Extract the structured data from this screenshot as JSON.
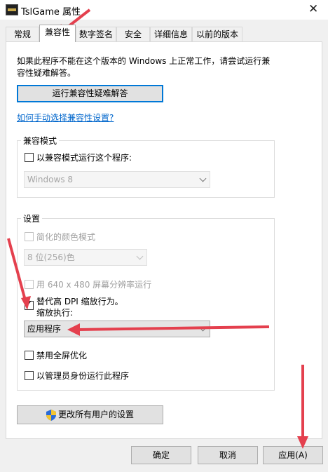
{
  "window": {
    "title": "TslGame 属性",
    "close_glyph": "✕"
  },
  "tabs": [
    {
      "label": "常规"
    },
    {
      "label": "兼容性"
    },
    {
      "label": "数字签名"
    },
    {
      "label": "安全"
    },
    {
      "label": "详细信息"
    },
    {
      "label": "以前的版本"
    }
  ],
  "compat": {
    "intro_line1": "如果此程序不能在这个版本的 Windows 上正常工作，请尝试运行兼",
    "intro_line2": "容性疑难解答。",
    "troubleshoot_button": "运行兼容性疑难解答",
    "manual_link": "如何手动选择兼容性设置?"
  },
  "compat_mode": {
    "group_label": "兼容模式",
    "checkbox_label": "以兼容模式运行这个程序:",
    "checked": false,
    "os_select_value": "Windows 8"
  },
  "settings": {
    "group_label": "设置",
    "reduced_color_label": "简化的颜色模式",
    "color_select_value": "8 位(256)色",
    "resolution_label": "用 640 x 480 屏幕分辨率运行",
    "dpi_label_line1": "替代高 DPI 缩放行为。",
    "dpi_label_line2": "缩放执行:",
    "dpi_checked": true,
    "dpi_select_value": "应用程序",
    "fullscreen_opt_label": "禁用全屏优化",
    "run_as_admin_label": "以管理员身份运行此程序"
  },
  "all_users_button": "更改所有用户的设置",
  "footer": {
    "ok": "确定",
    "cancel": "取消",
    "apply": "应用(A)"
  },
  "colors": {
    "annotation_arrow": "#e4404e",
    "focus_border": "#0078d7",
    "link": "#0066cc"
  }
}
